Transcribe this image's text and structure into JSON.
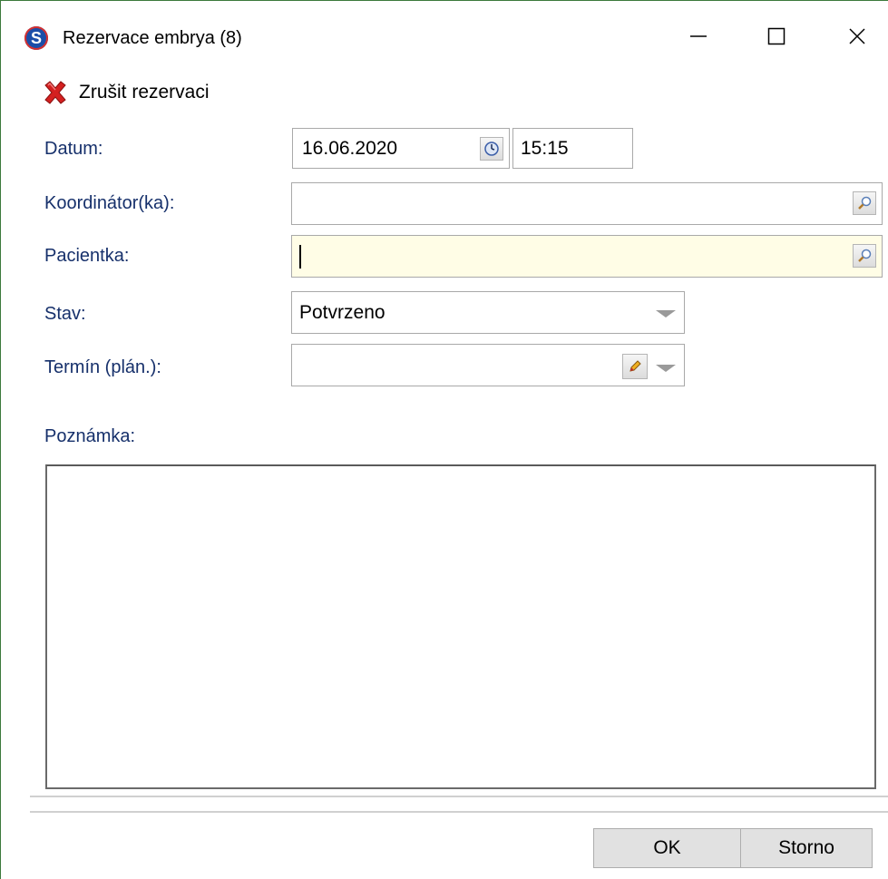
{
  "window": {
    "title": "Rezervace embrya (8)",
    "app_icon_letter": "S"
  },
  "toolbar": {
    "cancel_reservation_label": "Zrušit rezervaci"
  },
  "form": {
    "datum": {
      "label": "Datum:",
      "date_value": "16.06.2020",
      "time_value": "15:15"
    },
    "koordinator": {
      "label": "Koordinátor(ka):",
      "value": ""
    },
    "pacientka": {
      "label": "Pacientka:",
      "value": ""
    },
    "stav": {
      "label": "Stav:",
      "selected": "Potvrzeno"
    },
    "termin": {
      "label": "Termín (plán.):",
      "selected": ""
    },
    "poznamka": {
      "label": "Poznámka:",
      "value": ""
    }
  },
  "buttons": {
    "ok_label": "OK",
    "storno_label": "Storno"
  },
  "colors": {
    "label_text": "#16306b",
    "highlight_field": "#fffde6",
    "window_border": "#3c7a3c"
  },
  "icons": [
    "app-logo-icon",
    "minimize-icon",
    "maximize-icon",
    "close-icon",
    "red-x-icon",
    "clock-icon",
    "magnifier-icon",
    "pencil-icon",
    "chevron-down-icon"
  ]
}
